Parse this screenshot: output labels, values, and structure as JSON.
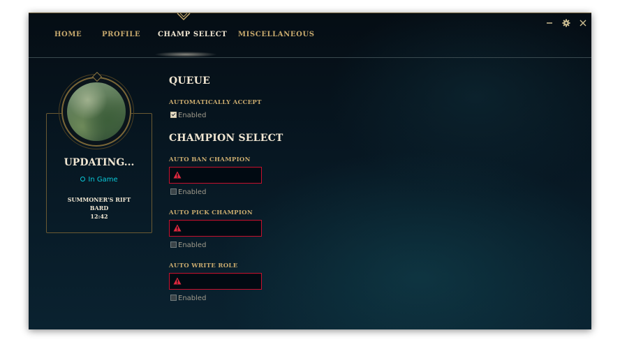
{
  "nav": {
    "tabs": [
      {
        "label": "HOME",
        "active": false
      },
      {
        "label": "PROFILE",
        "active": false
      },
      {
        "label": "CHAMP SELECT",
        "active": true
      },
      {
        "label": "MISCELLANEOUS",
        "active": false
      }
    ],
    "window_controls": [
      "minimize-icon",
      "settings-gear-icon",
      "close-icon"
    ]
  },
  "profile": {
    "summoner_name": "UPDATING...",
    "status": "In Game",
    "game_mode": "SUMMONER'S RIFT",
    "champion": "BARD",
    "game_time": "12:42"
  },
  "queue": {
    "heading": "QUEUE",
    "auto_accept": {
      "label": "AUTOMATICALLY ACCEPT",
      "checkbox_label": "Enabled",
      "checked": true
    }
  },
  "champion_select": {
    "heading": "CHAMPION SELECT",
    "auto_ban": {
      "label": "AUTO BAN CHAMPION",
      "value": "",
      "checkbox_label": "Enabled",
      "checked": false
    },
    "auto_pick": {
      "label": "AUTO PICK CHAMPION",
      "value": "",
      "checkbox_label": "Enabled",
      "checked": false
    },
    "auto_role": {
      "label": "AUTO WRITE ROLE",
      "value": "",
      "checkbox_label": "Enabled",
      "checked": false
    }
  },
  "colors": {
    "gold": "#c8aa6e",
    "light_gold": "#f0e6d2",
    "status_cyan": "#0ac8d8",
    "error_red": "#c8102e"
  }
}
